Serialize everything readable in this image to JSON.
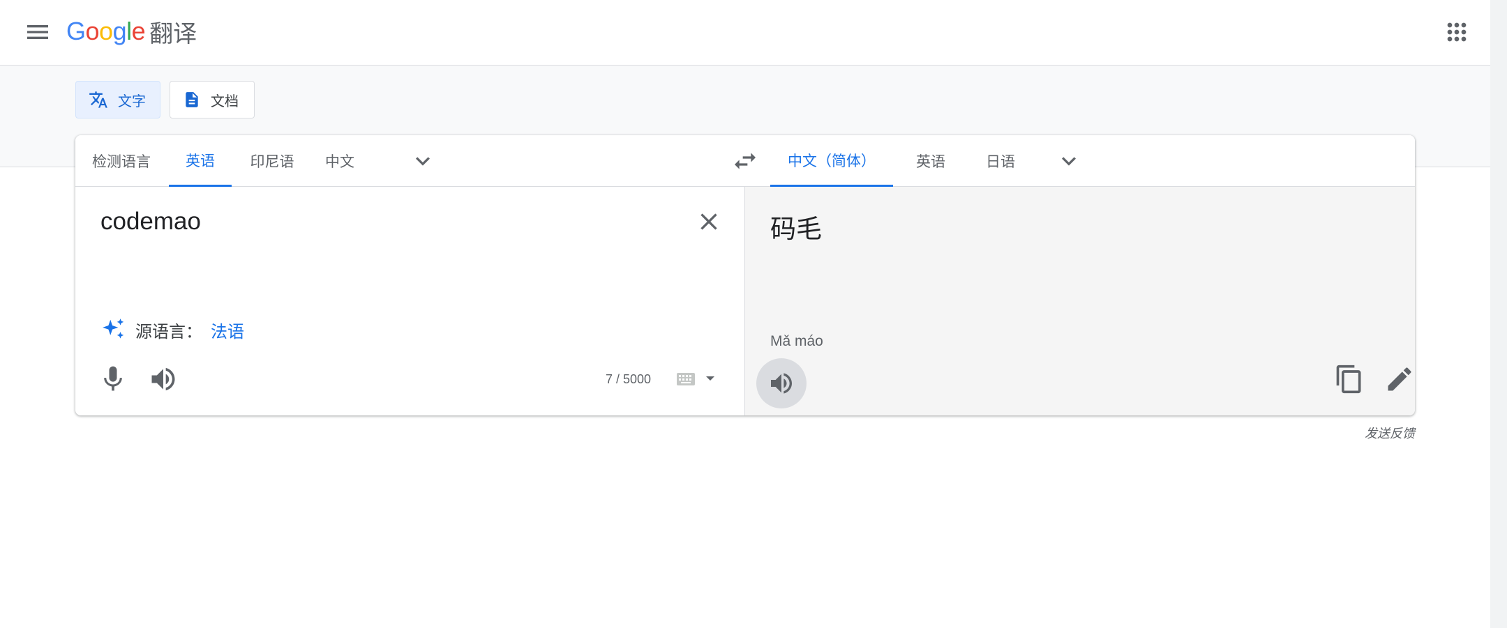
{
  "header": {
    "logo_letters": [
      "G",
      "o",
      "o",
      "g",
      "l",
      "e"
    ],
    "logo_colors": [
      "#4285f4",
      "#ea4335",
      "#fbbc05",
      "#4285f4",
      "#34a853",
      "#ea4335"
    ],
    "product_name": "翻译"
  },
  "modes": {
    "text_label": "文字",
    "docs_label": "文档"
  },
  "source_langs": {
    "detect": "检测语言",
    "english": "英语",
    "indonesian": "印尼语",
    "chinese": "中文"
  },
  "target_langs": {
    "chinese_simplified": "中文（简体）",
    "english": "英语",
    "japanese": "日语"
  },
  "source": {
    "text": "codemao",
    "detected_label": "源语言：",
    "detected_language": "法语",
    "char_count": "7 / 5000"
  },
  "target": {
    "text": "码毛",
    "transliteration": "Mǎ máo"
  },
  "footer": {
    "feedback": "发送反馈"
  },
  "colors": {
    "accent": "#1a73e8"
  }
}
